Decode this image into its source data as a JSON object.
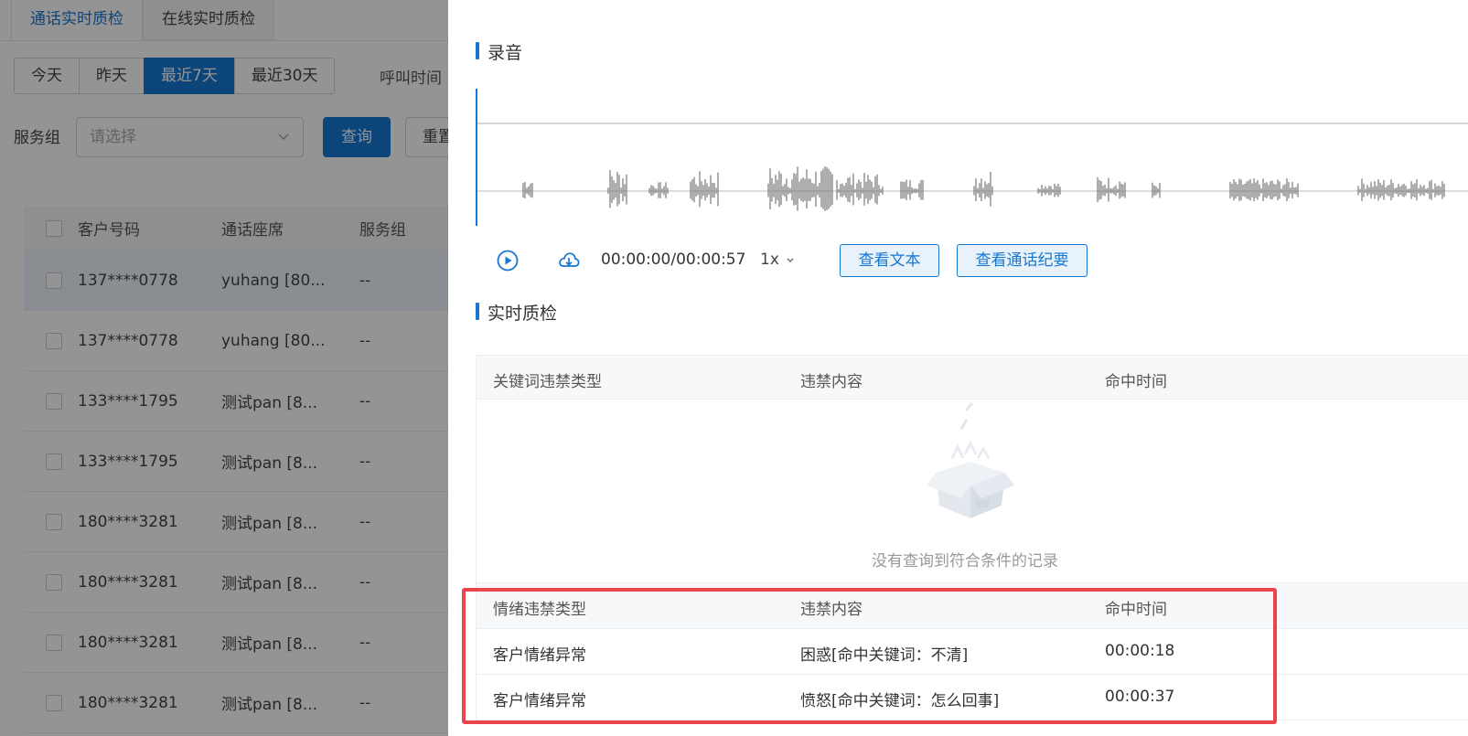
{
  "tabs": [
    "通话实时质检",
    "在线实时质检"
  ],
  "date_filters": [
    "今天",
    "昨天",
    "最近7天",
    "最近30天"
  ],
  "date_active_index": 2,
  "call_time_label": "呼叫时间",
  "service_group": {
    "label": "服务组",
    "placeholder": "请选择"
  },
  "buttons": {
    "query": "查询",
    "reset": "重置"
  },
  "list": {
    "headers": [
      "客户号码",
      "通话座席",
      "服务组"
    ],
    "rows": [
      {
        "phone": "137****0778",
        "agent": "yuhang [80...",
        "group": "--"
      },
      {
        "phone": "137****0778",
        "agent": "yuhang [80...",
        "group": "--"
      },
      {
        "phone": "133****1795",
        "agent": "测试pan [8...",
        "group": "--"
      },
      {
        "phone": "133****1795",
        "agent": "测试pan [8...",
        "group": "--"
      },
      {
        "phone": "180****3281",
        "agent": "测试pan [8...",
        "group": "--"
      },
      {
        "phone": "180****3281",
        "agent": "测试pan [8...",
        "group": "--"
      },
      {
        "phone": "180****3281",
        "agent": "测试pan [8...",
        "group": "--"
      },
      {
        "phone": "180****3281",
        "agent": "测试pan [8...",
        "group": "--"
      }
    ]
  },
  "drawer": {
    "recording_title": "录音",
    "player": {
      "time": "00:00:00/00:00:57",
      "speed": "1x",
      "view_text": "查看文本",
      "view_summary": "查看通话纪要"
    },
    "qc_title": "实时质检",
    "keyword_table": {
      "headers": [
        "关键词违禁类型",
        "违禁内容",
        "命中时间"
      ],
      "empty_text": "没有查询到符合条件的记录"
    },
    "emotion_table": {
      "headers": [
        "情绪违禁类型",
        "违禁内容",
        "命中时间"
      ],
      "rows": [
        {
          "type": "客户情绪异常",
          "content": "困惑[命中关键词：不清]",
          "time": "00:00:18"
        },
        {
          "type": "客户情绪异常",
          "content": "愤怒[命中关键词：怎么回事]",
          "time": "00:00:37"
        }
      ]
    }
  },
  "colors": {
    "accent": "#1677d2",
    "highlight": "#e8464a"
  }
}
